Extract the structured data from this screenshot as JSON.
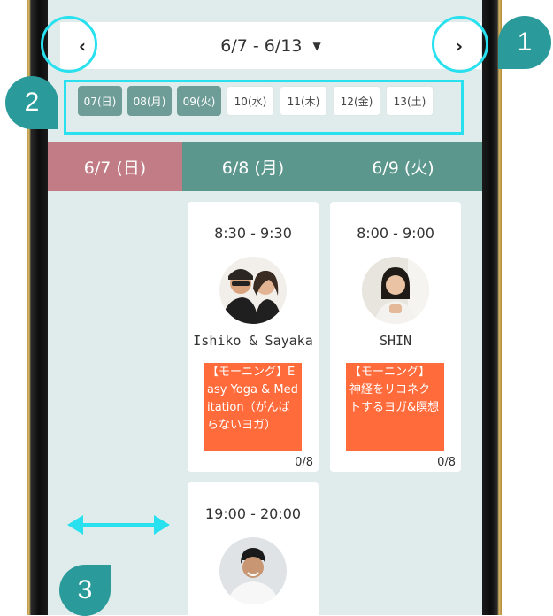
{
  "week_nav": {
    "range_label": "6/7 - 6/13",
    "prev_icon": "‹",
    "next_icon": "›",
    "caret_icon": "▼"
  },
  "day_tabs": [
    {
      "label": "07(日)",
      "active": true
    },
    {
      "label": "08(月)",
      "active": true
    },
    {
      "label": "09(火)",
      "active": true
    },
    {
      "label": "10(水)",
      "active": false
    },
    {
      "label": "11(木)",
      "active": false
    },
    {
      "label": "12(金)",
      "active": false
    },
    {
      "label": "13(土)",
      "active": false
    }
  ],
  "columns": [
    {
      "label": "6/7 (日)",
      "color": "#c27c86"
    },
    {
      "label": "6/8 (月)",
      "color": "#5b978c"
    },
    {
      "label": "6/9 (火)",
      "color": "#5b978c"
    }
  ],
  "lessons": [
    {
      "time": "8:30 - 9:30",
      "instructor": "Ishiko & Sayaka",
      "title": "【モーニング】Easy Yoga & Meditation（がんばらないヨガ）",
      "capacity": "0/8"
    },
    {
      "time": "8:00 - 9:00",
      "instructor": "SHIN",
      "title": "【モーニング】神経をリコネクトするヨガ&瞑想",
      "capacity": "0/8"
    },
    {
      "time": "19:00 - 20:00"
    }
  ],
  "annotations": {
    "badge_1": "1",
    "badge_2": "2",
    "badge_3": "3",
    "highlight_color": "#29e0ee",
    "badge_color": "#2a9a9a",
    "swipe_icon": "double-arrow-icon"
  },
  "colors": {
    "screen_bg": "#e0ecec",
    "tab_active": "#6e9c97",
    "class_box": "#ff6b3b"
  }
}
